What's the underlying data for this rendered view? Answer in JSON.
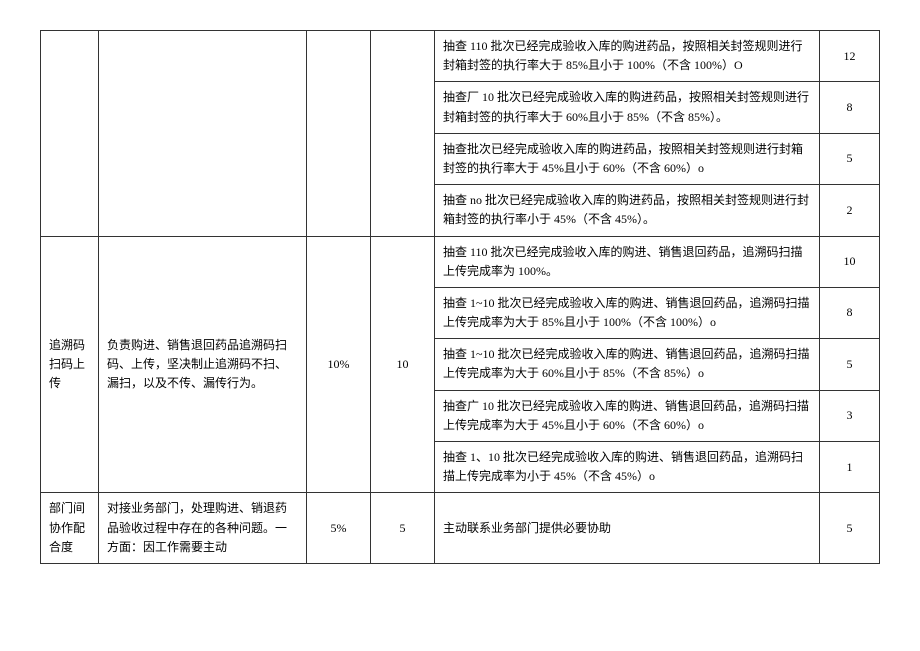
{
  "section1": {
    "rows": [
      {
        "criteria": "抽查 110 批次已经完成验收入库的购进药品，按照相关封签规则进行封箱封签的执行率大于 85%且小于 100%（不含 100%）O",
        "value": "12"
      },
      {
        "criteria": "抽查厂 10 批次已经完成验收入库的购进药品，按照相关封签规则进行封箱封签的执行率大于 60%且小于 85%（不含 85%）。",
        "value": "8"
      },
      {
        "criteria": "抽查批次已经完成验收入库的购进药品，按照相关封签规则进行封箱封签的执行率大于 45%且小于 60%（不含 60%）o",
        "value": "5"
      },
      {
        "criteria": "抽查 no 批次已经完成验收入库的购进药品，按照相关封签规则进行封箱封签的执行率小于 45%（不含 45%）。",
        "value": "2"
      }
    ]
  },
  "section2": {
    "name": "追溯码扫码上传",
    "desc": "负责购进、销售退回药品追溯码扫码、上传，坚决制止追溯码不扫、漏扫，以及不传、漏传行为。",
    "pct": "10%",
    "score": "10",
    "rows": [
      {
        "criteria": "抽查 110 批次已经完成验收入库的购进、销售退回药品，追溯码扫描上传完成率为 100%。",
        "value": "10"
      },
      {
        "criteria": "抽查 1~10 批次已经完成验收入库的购进、销售退回药品，追溯码扫描上传完成率为大于 85%且小于 100%（不含 100%）o",
        "value": "8"
      },
      {
        "criteria": "抽查 1~10 批次已经完成验收入库的购进、销售退回药品，追溯码扫描上传完成率为大于 60%且小于 85%（不含 85%）o",
        "value": "5"
      },
      {
        "criteria": "抽查广 10 批次已经完成验收入库的购进、销售退回药品，追溯码扫描上传完成率为大于 45%且小于 60%（不含 60%）o",
        "value": "3"
      },
      {
        "criteria": "抽查 1、10 批次已经完成验收入库的购进、销售退回药品，追溯码扫描上传完成率为小于 45%（不含 45%）o",
        "value": "1"
      }
    ]
  },
  "section3": {
    "name": "部门间协作配合度",
    "desc": "对接业务部门，处理购进、销退药品验收过程中存在的各种问题。一方面：因工作需要主动",
    "pct": "5%",
    "score": "5",
    "rows": [
      {
        "criteria": "主动联系业务部门提供必要协助",
        "value": "5"
      }
    ]
  }
}
